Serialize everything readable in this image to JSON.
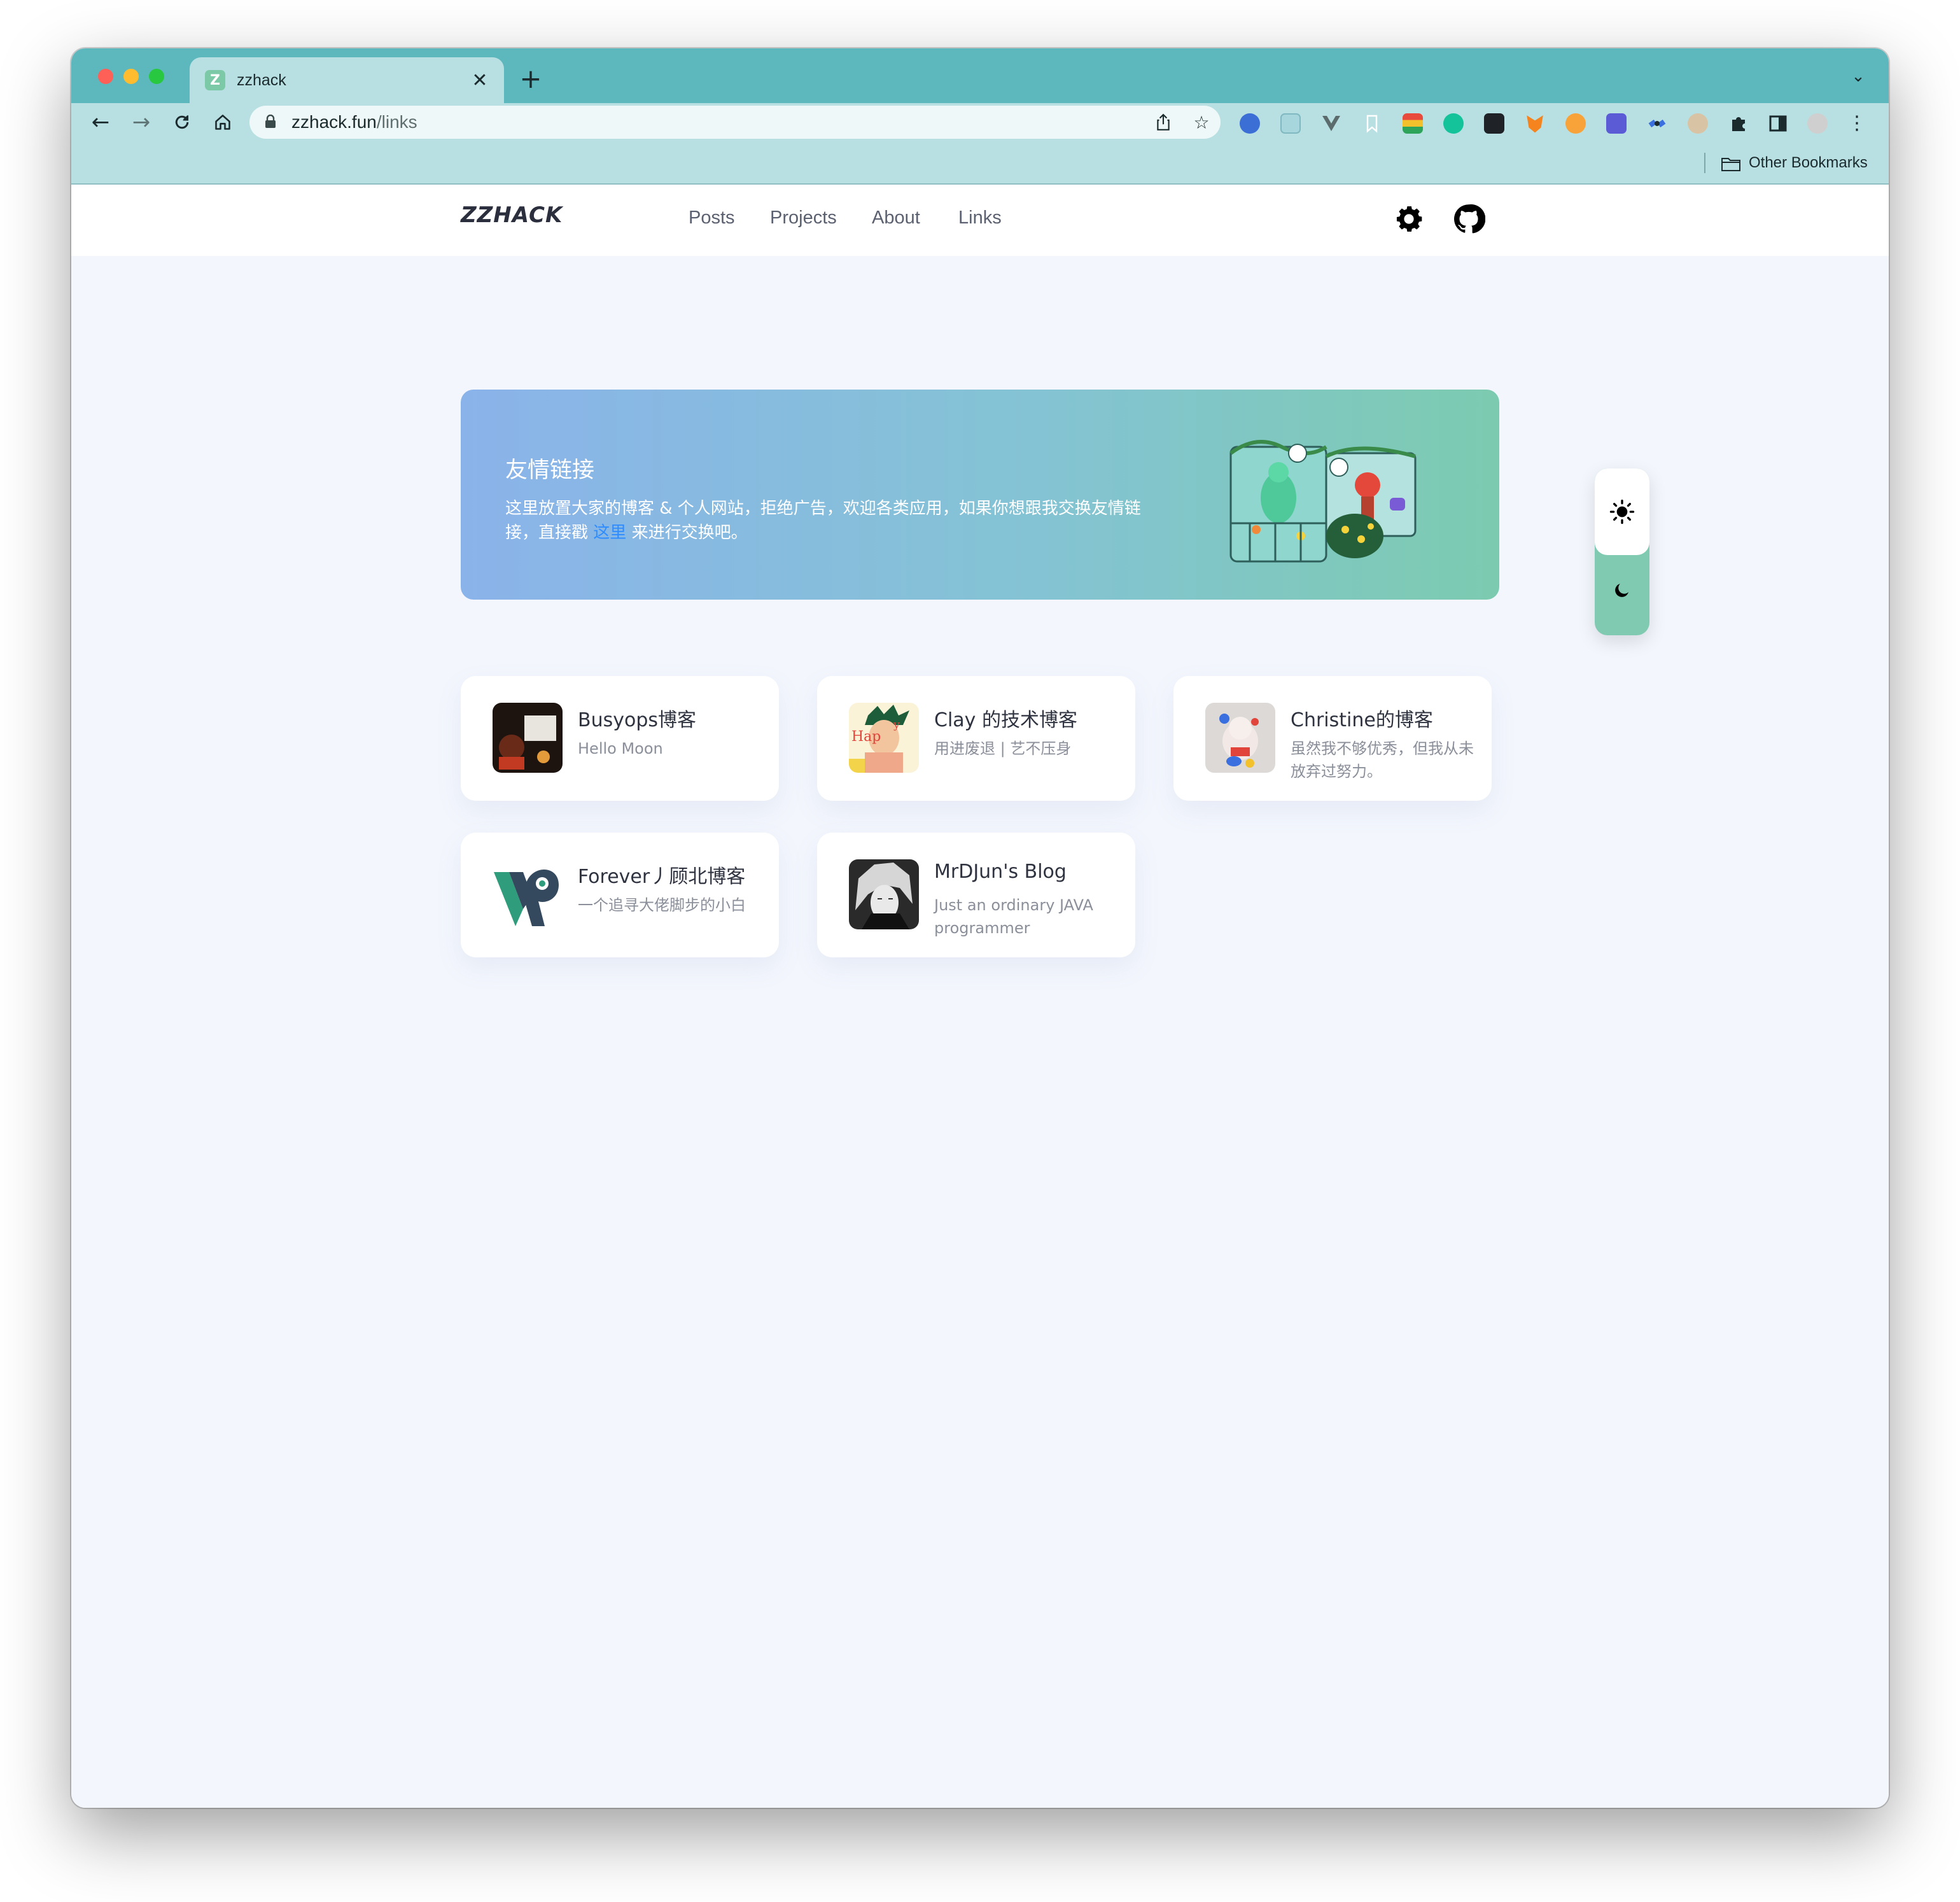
{
  "browser": {
    "tab": {
      "favicon": "Z",
      "title": "zzhack"
    },
    "url": {
      "host": "zzhack.fun",
      "path": "/links"
    },
    "bookmarks": {
      "other_label": "Other Bookmarks"
    }
  },
  "site": {
    "logo": "ZZHACK",
    "nav": [
      {
        "label": "Posts"
      },
      {
        "label": "Projects"
      },
      {
        "label": "About"
      },
      {
        "label": "Links"
      }
    ]
  },
  "banner": {
    "title": "友情链接",
    "desc_before": "这里放置大家的博客 & 个人网站，拒绝广告，欢迎各类应用，如果你想跟我交换友情链接，直接戳",
    "link_text": "这里",
    "desc_after": "来进行交换吧。"
  },
  "links": [
    {
      "title": "Busyops博客",
      "desc": "Hello Moon"
    },
    {
      "title": "Clay 的技术博客",
      "desc": "用进废退 | 艺不压身"
    },
    {
      "title": "Christine的博客",
      "desc": "虽然我不够优秀，但我从未放弃过努力。"
    },
    {
      "title": "Forever丿顾北博客",
      "desc": "一个追寻大佬脚步的小白"
    },
    {
      "title": "MrDJun's Blog",
      "desc": "Just an ordinary JAVA programmer"
    }
  ],
  "colors": {
    "tab_strip": "#5db8be",
    "toolbar": "#b8e0e2",
    "page_bg": "#f3f6fd",
    "accent_link": "#2e8cff",
    "theme_switch": "#7fcab0"
  }
}
